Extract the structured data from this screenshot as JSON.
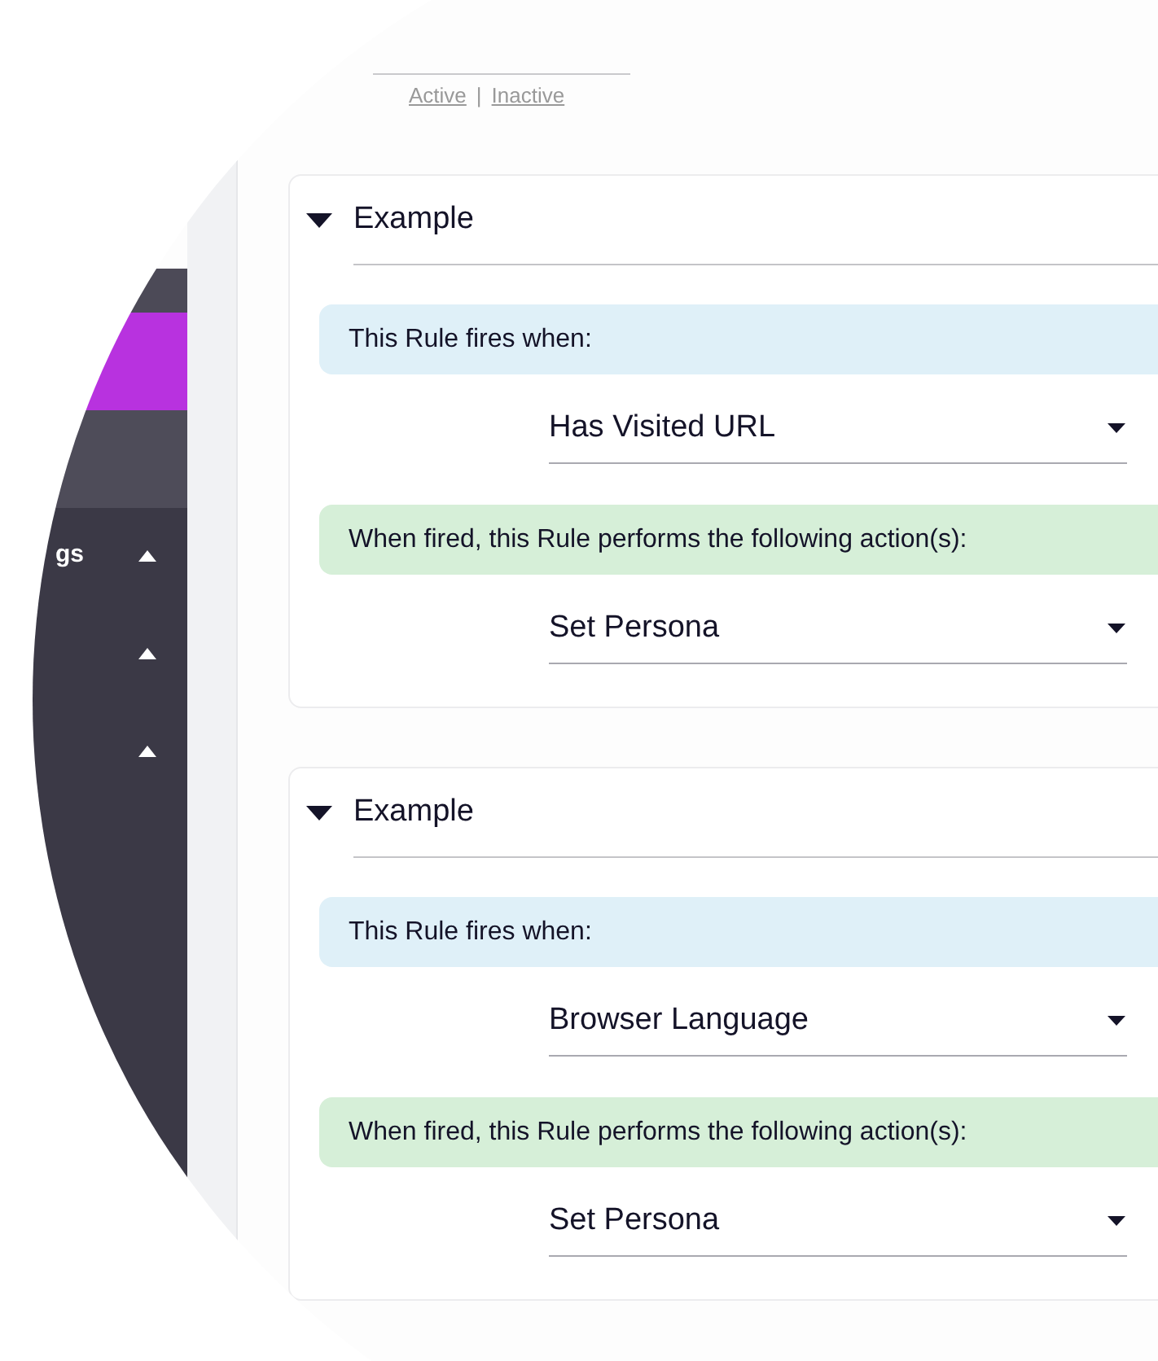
{
  "filters": [
    {
      "label": "Active"
    },
    {
      "label": "Inactive"
    }
  ],
  "filter_separator": "|",
  "sidebar": {
    "blocks": [
      {
        "selected": false
      },
      {
        "selected": true
      },
      {
        "selected": false
      }
    ],
    "items": [
      {
        "label": "gs",
        "expanded": true
      },
      {
        "expanded": true
      },
      {
        "expanded": true
      }
    ]
  },
  "rules": [
    {
      "title": "Example",
      "expanded": true,
      "trigger_label": "This Rule fires when:",
      "trigger_value": "Has Visited URL",
      "action_label": "When fired, this Rule performs the following action(s):",
      "action_value": "Set Persona"
    },
    {
      "title": "Example",
      "expanded": true,
      "trigger_label": "This Rule fires when:",
      "trigger_value": "Browser Language",
      "action_label": "When fired, this Rule performs the following action(s):",
      "action_value": "Set Persona"
    }
  ]
}
